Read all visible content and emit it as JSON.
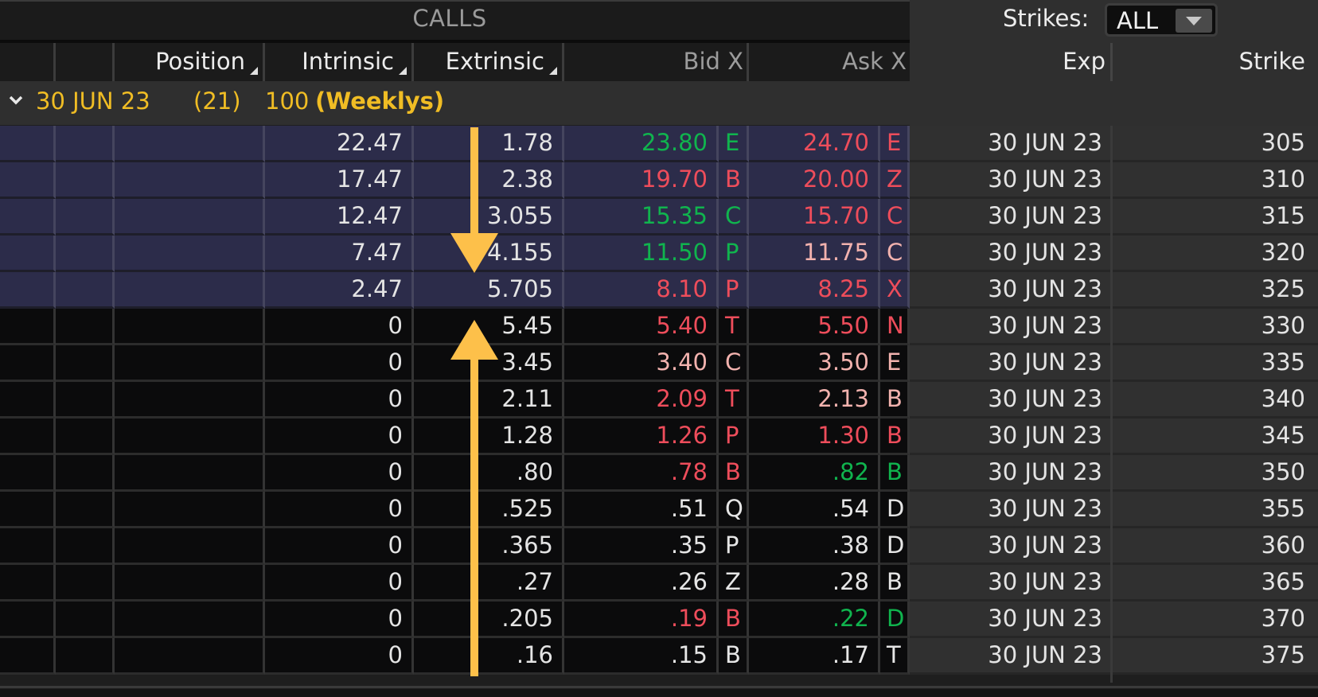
{
  "header": {
    "section_title": "CALLS",
    "strikes_label": "Strikes:",
    "strikes_value": "ALL"
  },
  "columns": {
    "position": "Position",
    "intrinsic": "Intrinsic",
    "extrinsic": "Extrinsic",
    "bid": "Bid X",
    "ask": "Ask X",
    "exp": "Exp",
    "strike": "Strike"
  },
  "group": {
    "expiration": "30 JUN 23",
    "days": "(21)",
    "multiplier": "100",
    "label": "(Weeklys)"
  },
  "colors": {
    "accent": "#f0bd24",
    "up": "#10b44e",
    "down": "#ee4d5b",
    "neutral_down": "#f2b2ae",
    "itm_bg": "#2c2c4a",
    "otm_bg": "#0b0b0c",
    "arrow": "#fdc04a"
  },
  "annotations": [
    {
      "type": "arrow-down",
      "column": "extrinsic",
      "description": "points down toward 325 strike"
    },
    {
      "type": "arrow-up",
      "column": "extrinsic",
      "description": "points up toward 330 strike"
    }
  ],
  "rows": [
    {
      "itm": true,
      "intrinsic": "22.47",
      "extrinsic": "1.78",
      "bid": "23.80",
      "bid_x": "E",
      "bid_color": "green",
      "ask": "24.70",
      "ask_x": "E",
      "ask_color": "red",
      "exp": "30 JUN 23",
      "strike": "305"
    },
    {
      "itm": true,
      "intrinsic": "17.47",
      "extrinsic": "2.38",
      "bid": "19.70",
      "bid_x": "B",
      "bid_color": "red",
      "ask": "20.00",
      "ask_x": "Z",
      "ask_color": "red",
      "exp": "30 JUN 23",
      "strike": "310"
    },
    {
      "itm": true,
      "intrinsic": "12.47",
      "extrinsic": "3.055",
      "bid": "15.35",
      "bid_x": "C",
      "bid_color": "green",
      "ask": "15.70",
      "ask_x": "C",
      "ask_color": "red",
      "exp": "30 JUN 23",
      "strike": "315"
    },
    {
      "itm": true,
      "intrinsic": "7.47",
      "extrinsic": "4.155",
      "bid": "11.50",
      "bid_x": "P",
      "bid_color": "green",
      "ask": "11.75",
      "ask_x": "C",
      "ask_color": "pink",
      "exp": "30 JUN 23",
      "strike": "320"
    },
    {
      "itm": true,
      "intrinsic": "2.47",
      "extrinsic": "5.705",
      "bid": "8.10",
      "bid_x": "P",
      "bid_color": "red",
      "ask": "8.25",
      "ask_x": "X",
      "ask_color": "red",
      "exp": "30 JUN 23",
      "strike": "325"
    },
    {
      "itm": false,
      "intrinsic": "0",
      "extrinsic": "5.45",
      "bid": "5.40",
      "bid_x": "T",
      "bid_color": "red",
      "ask": "5.50",
      "ask_x": "N",
      "ask_color": "red",
      "exp": "30 JUN 23",
      "strike": "330"
    },
    {
      "itm": false,
      "intrinsic": "0",
      "extrinsic": "3.45",
      "bid": "3.40",
      "bid_x": "C",
      "bid_color": "pink",
      "ask": "3.50",
      "ask_x": "E",
      "ask_color": "pink",
      "exp": "30 JUN 23",
      "strike": "335"
    },
    {
      "itm": false,
      "intrinsic": "0",
      "extrinsic": "2.11",
      "bid": "2.09",
      "bid_x": "T",
      "bid_color": "red",
      "ask": "2.13",
      "ask_x": "B",
      "ask_color": "pink",
      "exp": "30 JUN 23",
      "strike": "340"
    },
    {
      "itm": false,
      "intrinsic": "0",
      "extrinsic": "1.28",
      "bid": "1.26",
      "bid_x": "P",
      "bid_color": "red",
      "ask": "1.30",
      "ask_x": "B",
      "ask_color": "red",
      "exp": "30 JUN 23",
      "strike": "345"
    },
    {
      "itm": false,
      "intrinsic": "0",
      "extrinsic": ".80",
      "bid": ".78",
      "bid_x": "B",
      "bid_color": "red",
      "ask": ".82",
      "ask_x": "B",
      "ask_color": "green",
      "exp": "30 JUN 23",
      "strike": "350"
    },
    {
      "itm": false,
      "intrinsic": "0",
      "extrinsic": ".525",
      "bid": ".51",
      "bid_x": "Q",
      "bid_color": "white",
      "ask": ".54",
      "ask_x": "D",
      "ask_color": "white",
      "exp": "30 JUN 23",
      "strike": "355"
    },
    {
      "itm": false,
      "intrinsic": "0",
      "extrinsic": ".365",
      "bid": ".35",
      "bid_x": "P",
      "bid_color": "white",
      "ask": ".38",
      "ask_x": "D",
      "ask_color": "white",
      "exp": "30 JUN 23",
      "strike": "360"
    },
    {
      "itm": false,
      "intrinsic": "0",
      "extrinsic": ".27",
      "bid": ".26",
      "bid_x": "Z",
      "bid_color": "white",
      "ask": ".28",
      "ask_x": "B",
      "ask_color": "white",
      "exp": "30 JUN 23",
      "strike": "365"
    },
    {
      "itm": false,
      "intrinsic": "0",
      "extrinsic": ".205",
      "bid": ".19",
      "bid_x": "B",
      "bid_color": "red",
      "ask": ".22",
      "ask_x": "D",
      "ask_color": "green",
      "exp": "30 JUN 23",
      "strike": "370"
    },
    {
      "itm": false,
      "intrinsic": "0",
      "extrinsic": ".16",
      "bid": ".15",
      "bid_x": "B",
      "bid_color": "white",
      "ask": ".17",
      "ask_x": "T",
      "ask_color": "white",
      "exp": "30 JUN 23",
      "strike": "375"
    }
  ]
}
